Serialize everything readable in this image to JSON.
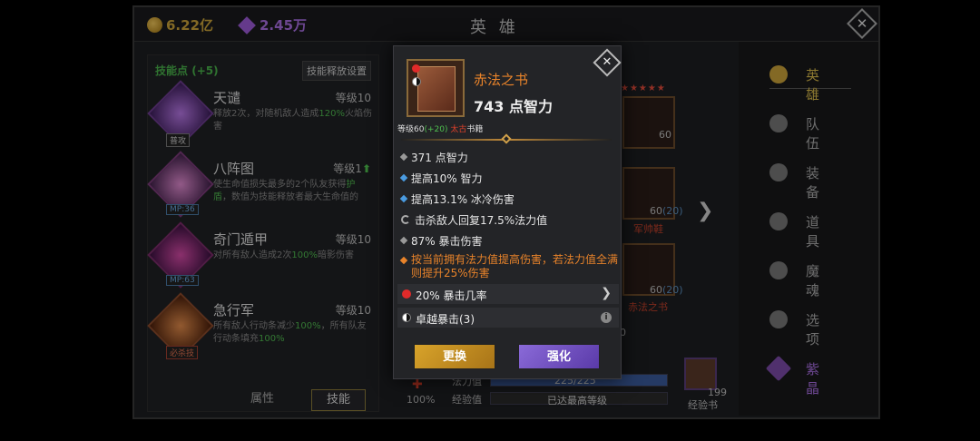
{
  "topbar": {
    "gold": "6.22亿",
    "gems": "2.45万",
    "title": "英 雄"
  },
  "skills": {
    "points_label": "技能点",
    "points_value": "(+5)",
    "release_label": "技能释放设置",
    "items": [
      {
        "name": "天谴",
        "level": "等级10",
        "tag": "普攻",
        "desc_a": "释放2次，对随机敌人造成",
        "desc_hl": "120%",
        "desc_b": "火焰伤害"
      },
      {
        "name": "八阵图",
        "level": "等级1",
        "tag": "MP:36",
        "desc_a": "使生命值损失最多的2个队友获得",
        "desc_hl": "护盾",
        "desc_b": "，数值为技能释放者最大生命值的"
      },
      {
        "name": "奇门遁甲",
        "level": "等级10",
        "tag": "MP:63",
        "desc_a": "对所有敌人造成2次",
        "desc_hl": "100%",
        "desc_b": "暗影伤害"
      },
      {
        "name": "急行军",
        "level": "等级10",
        "tag": "必杀技",
        "desc_a": "所有敌人行动条减少",
        "desc_hl": "100%",
        "desc_b": "，所有队友行动条填充",
        "desc_hl2": "100%"
      }
    ],
    "tabs": [
      "属性",
      "技能"
    ]
  },
  "hero_slots": {
    "slot1_level": "60",
    "slot2_level": "60",
    "slot2_plus": "(20)",
    "slot2_name": "军帅鞋",
    "slot3_level": "60",
    "slot3_plus": "(20)",
    "slot3_name": "赤法之书",
    "hidden_level": "60"
  },
  "stats": {
    "heal_pct": "100%",
    "mp_label": "法力值",
    "mp_value": "225/225",
    "mp_fraction": 1.0,
    "xp_label": "经验值",
    "xp_value": "已达最高等级",
    "book_count": "199",
    "book_label": "经验书"
  },
  "nav": [
    "英 雄",
    "队 伍",
    "装 备",
    "道 具",
    "魔 魂",
    "选 项",
    "紫 晶"
  ],
  "popup": {
    "item_name": "赤法之书",
    "main_stat": "743 点智力",
    "level_label": "等级60",
    "level_plus": "(+20)",
    "rarity": "太古",
    "category": "书籍",
    "lines": [
      "371 点智力",
      "提高10% 智力",
      "提高13.1% 冰冷伤害",
      "击杀敌人回复17.5%法力值",
      "87% 暴击伤害"
    ],
    "special": "按当前拥有法力值提高伤害，若法力值全满则提升25%伤害",
    "socket": "20% 暴击几率",
    "set": "卓越暴击(3)",
    "btn_replace": "更换",
    "btn_enhance": "强化"
  },
  "colors": {
    "gold": "#c9a13a",
    "purple": "#a86ee0",
    "item_name": "#e8832a",
    "green": "#4fc04f"
  }
}
